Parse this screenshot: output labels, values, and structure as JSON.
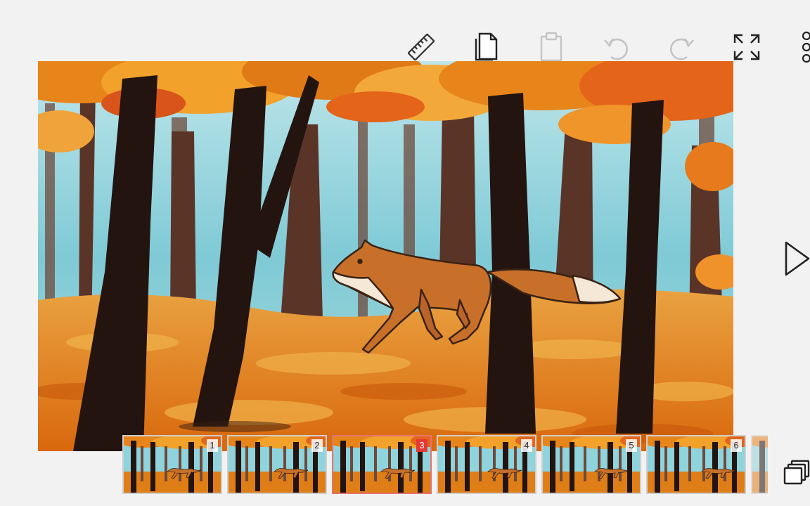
{
  "toolbar": {
    "buttons": [
      {
        "name": "ruler-icon",
        "enabled": true
      },
      {
        "name": "copy-icon",
        "enabled": true
      },
      {
        "name": "paste-icon",
        "enabled": false
      },
      {
        "name": "undo-icon",
        "enabled": false
      },
      {
        "name": "redo-icon",
        "enabled": false
      },
      {
        "name": "fullscreen-icon",
        "enabled": true
      },
      {
        "name": "more-icon",
        "enabled": true
      }
    ]
  },
  "side": {
    "play_icon": "play-icon",
    "frames_icon": "layers-icon"
  },
  "frames": {
    "items": [
      {
        "number": "1",
        "active": false
      },
      {
        "number": "2",
        "active": false
      },
      {
        "number": "3",
        "active": true
      },
      {
        "number": "4",
        "active": false
      },
      {
        "number": "5",
        "active": false
      },
      {
        "number": "6",
        "active": false
      }
    ],
    "active_color": "#e53935"
  },
  "colors": {
    "sky": "#8fd3dc",
    "ground": "#e07b12",
    "foliage": "#f29a1a",
    "trunk": "#2a1712",
    "fox": "#c8702a"
  }
}
